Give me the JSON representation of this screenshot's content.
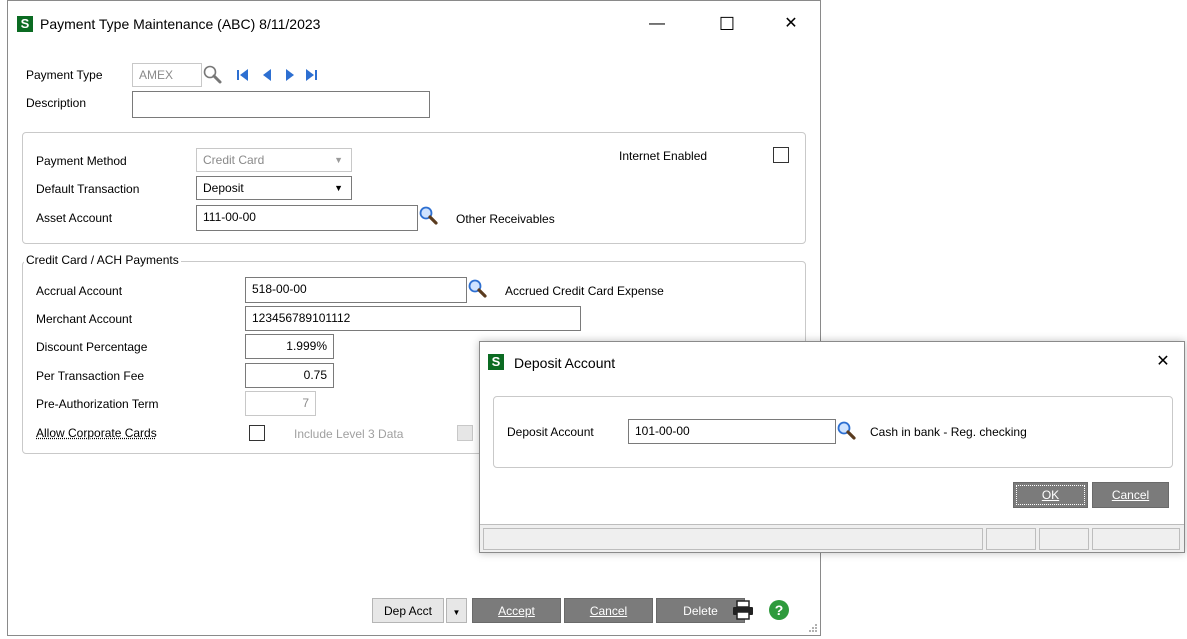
{
  "main": {
    "title": "Payment Type Maintenance (ABC) 8/11/2023",
    "minimize": "—",
    "maximize": "☐",
    "close": "✕",
    "payment_type_label": "Payment Type",
    "payment_type_value": "AMEX",
    "description_label": "Description",
    "description_value": "",
    "payment_method_label": "Payment Method",
    "payment_method_value": "Credit Card",
    "internet_enabled_label": "Internet Enabled",
    "default_transaction_label": "Default Transaction",
    "default_transaction_value": "Deposit",
    "asset_account_label": "Asset Account",
    "asset_account_value": "111-00-00",
    "asset_account_desc": "Other Receivables",
    "cc_group_title": "Credit Card / ACH Payments",
    "accrual_account_label": "Accrual Account",
    "accrual_account_value": "518-00-00",
    "accrual_account_desc": "Accrued Credit Card Expense",
    "merchant_account_label": "Merchant Account",
    "merchant_account_value": "123456789101112",
    "discount_percentage_label": "Discount Percentage",
    "discount_percentage_value": "1.999%",
    "per_transaction_fee_label": "Per Transaction Fee",
    "per_transaction_fee_value": "0.75",
    "preauth_term_label": "Pre-Authorization Term",
    "preauth_term_value": "7",
    "allow_corporate_label": "Allow Corporate Cards",
    "include_level3_label": "Include Level 3 Data",
    "footer": {
      "dep_acct": "Dep Acct",
      "accept": "Accept",
      "cancel": "Cancel",
      "delete": "Delete"
    }
  },
  "dialog": {
    "title": "Deposit Account",
    "close": "✕",
    "deposit_account_label": "Deposit Account",
    "deposit_account_value": "101-00-00",
    "deposit_account_desc": "Cash in bank - Reg. checking",
    "ok": "OK",
    "cancel": "Cancel"
  },
  "colors": {
    "app_icon": "#0b6b22",
    "button_dark": "#7b7b7b",
    "lookup_blue": "#2d6fd1"
  }
}
